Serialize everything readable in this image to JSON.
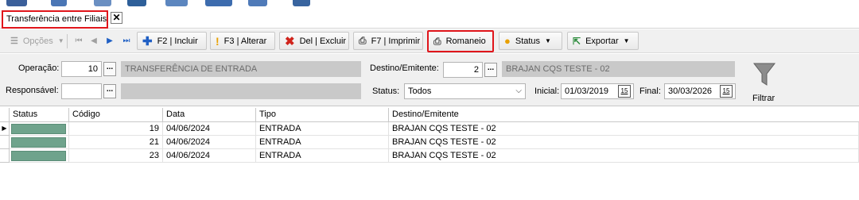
{
  "tab": {
    "title": "Transferência entre Filiais",
    "close_glyph": "✕"
  },
  "toolbar": {
    "options_label": "Opções",
    "first_glyph": "⏮",
    "prev_glyph": "◀",
    "next_glyph": "▶",
    "last_glyph": "⏭",
    "add_label": "F2 | Incluir",
    "edit_label": "F3 | Alterar",
    "delete_label": "Del | Excluir",
    "print_label": "F7 | Imprimir",
    "romaneio_label": "Romaneio",
    "status_label": "Status",
    "export_label": "Exportar"
  },
  "filter": {
    "operacao_label": "Operação:",
    "operacao_value": "10",
    "operacao_desc": "TRANSFERÊNCIA DE ENTRADA",
    "responsavel_label": "Responsável:",
    "responsavel_value": "",
    "responsavel_desc": "",
    "destino_label": "Destino/Emitente:",
    "destino_value": "2",
    "destino_desc": "BRAJAN CQS TESTE - 02",
    "status_label": "Status:",
    "status_value": "Todos",
    "inicial_label": "Inicial:",
    "inicial_value": "01/03/2019",
    "final_label": "Final:",
    "final_value": "30/03/2026",
    "filtrar_label": "Filtrar",
    "lookup_glyph": "...",
    "calendar_glyph": "15"
  },
  "grid": {
    "columns": [
      "Status",
      "Código",
      "Data",
      "Tipo",
      "Destino/Emitente"
    ],
    "status_color": "#6fa38c",
    "rows": [
      {
        "codigo": "19",
        "data": "04/06/2024",
        "tipo": "ENTRADA",
        "destino": "BRAJAN CQS TESTE - 02",
        "current": true
      },
      {
        "codigo": "21",
        "data": "04/06/2024",
        "tipo": "ENTRADA",
        "destino": "BRAJAN CQS TESTE - 02",
        "current": false
      },
      {
        "codigo": "23",
        "data": "04/06/2024",
        "tipo": "ENTRADA",
        "destino": "BRAJAN CQS TESTE - 02",
        "current": false
      }
    ]
  },
  "colors": {
    "highlight": "#e0151b",
    "readonly_bg": "#c9c9c9",
    "panel_bg": "#f0f0f0"
  }
}
